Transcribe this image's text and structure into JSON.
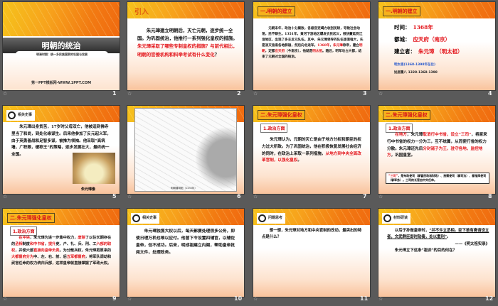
{
  "slides": [
    {
      "num": "1",
      "title": "明朝的统治",
      "subtitle": "明清时期：统一多民族国家的巩固与发展",
      "footer": "第一PPT模板网-WWW.1PPT.COM"
    },
    {
      "num": "2",
      "heading": "引入",
      "paras": [
        [
          {
            "t": "朱元璋建立明朝后，灭亡元朝，逐步统一全国。为巩固统治，他推行一系列强化皇权的措施。"
          },
          {
            "t": "朱元璋采取了哪些专制皇权的措施？与前代相比，明朝的官僚机构和科举考试有什么变化",
            "r": 1
          },
          {
            "t": "？"
          }
        ]
      ]
    },
    {
      "num": "3",
      "heading": "一.明朝的建立",
      "paras": [
        [
          {
            "t": "元朝末年，政治十分腐败，各级官吏竭力收刮民财，导致社会动荡，民不聊生。1351年，黄河下游地区爆发农民起义，很快蔓延到江淮地区，出现了多支反元队伍。其中，朱元璋领导的队伍逐渐强大，先是消灭淮南各地群雄，然后向北进军。"
          },
          {
            "t": "1368年",
            "r": 1
          },
          {
            "t": "，"
          },
          {
            "t": "朱元璋",
            "r": 1
          },
          {
            "t": "称帝，建立"
          },
          {
            "t": "明朝",
            "r": 1
          },
          {
            "t": "，定都"
          },
          {
            "t": "应天府",
            "r": 1
          },
          {
            "t": "（今南京），他就是"
          },
          {
            "t": "明太祖",
            "r": 1
          },
          {
            "t": "。随后，明军攻占大都，结束了元朝对全国的统治。"
          }
        ]
      ]
    },
    {
      "num": "4",
      "heading": "一.明朝的建立",
      "rows": [
        {
          "k": "时间：",
          "v": "1368年"
        },
        {
          "k": "都城：",
          "v": "应天府（南京）"
        },
        {
          "k": "建立者：",
          "v": "朱元璋 （明太祖）"
        }
      ],
      "note1": "明太祖(1368-1398年在位)",
      "note2": "姑居重八  1328-1368-1398"
    },
    {
      "num": "5",
      "badge": "相关史事",
      "paras": [
        [
          {
            "t": "朱元璋出身贫苦，17岁时父母双亡，他被迫到佛寺里当了和尚，到处化缘谋生。后来他参加了反元起义军，由于英勇善战和足智多谋，被推为领袖。他采取“高筑墙，广积粮，缓称王”的策略，逐步发展壮大，最终统一全国。"
          }
        ]
      ],
      "caption": "朱元璋像"
    },
    {
      "num": "6",
      "map_caption": "明朝疆域图（1433年）"
    },
    {
      "num": "7",
      "heading": "二.朱元璋强化皇权",
      "sub": "1.政治方面",
      "paras": [
        [
          {
            "t": "朱元璋认为，元朝的灭亡是由于地方分权和朝臣的权力过大所致。为了巩固统治，他在积极恢复发展社会经济的同时，在政治上采取一系列措施，"
          },
          {
            "t": "从地方到中央全面改革官制，以强化皇权",
            "r": 1
          },
          {
            "t": "。"
          }
        ]
      ]
    },
    {
      "num": "8",
      "heading": "二.朱元璋强化皇权",
      "sub": "1.政治方面",
      "paras": [
        [
          {
            "t": "在地方",
            "r": 1
          },
          {
            "t": "，朱元璋"
          },
          {
            "t": "取消行中书省，设立“三司”",
            "r": 1
          },
          {
            "t": "，将原来行中书省的权力一分为三，互不统属，从而使行省的权力分散。朱元璋还先后"
          },
          {
            "t": "分封诸子为王，驻守各地，监控地方",
            "r": 1
          },
          {
            "t": "，巩固皇室。"
          }
        ]
      ],
      "box": [
        {
          "t": "“三司”",
          "r": 1
        },
        {
          "t": "，是布政使司（掌管民政和财政）、按察使司（掌司法）、都指挥使司（掌军务）。三司的长官由中央任命。"
        }
      ]
    },
    {
      "num": "9",
      "heading": "二.朱元璋强化皇权",
      "sub": "1.政治方面",
      "paras": [
        [
          {
            "t": "在中央",
            "r": 1
          },
          {
            "t": "，朱元璋为进一步集中权力，"
          },
          {
            "t": "废除",
            "r": 1
          },
          {
            "t": "了以往长期存在的"
          },
          {
            "t": "丞相",
            "r": 1
          },
          {
            "t": "制度"
          },
          {
            "t": "和中书省",
            "r": 1
          },
          {
            "t": "，"
          },
          {
            "t": "提升",
            "r": 1
          },
          {
            "t": "吏、户、礼、兵、刑、工"
          },
          {
            "t": "六部的职权",
            "r": 1
          },
          {
            "t": "，并使六部"
          },
          {
            "t": "直接向皇帝负责",
            "r": 1
          },
          {
            "t": "。为分散兵权，朱元璋把原来的"
          },
          {
            "t": "大都督府分为",
            "r": 1
          },
          {
            "t": "中、左、右、前、后"
          },
          {
            "t": "五军都督府",
            "r": 1
          },
          {
            "t": "，将军队调动和武官任命的权力统归兵部，这样皇帝就直接掌握了军政大权。"
          }
        ]
      ]
    },
    {
      "num": "10",
      "badge": "相关史事",
      "paras": [
        [
          {
            "t": "朱元璋独揽大权以后，每天都要处理很多公务，即使日理万机也难以应付。他曾下令设置四辅官，以辅佐皇帝，但不成功。后来，明成祖建立内阁，帮助皇帝批阅文件，处理政务。"
          }
        ]
      ]
    },
    {
      "num": "11",
      "badge": "问题思考",
      "paras": [
        [
          {
            "t": "想一想，朱元璋对地方和中央官制的改动，最突出的特点是什么？"
          }
        ]
      ]
    },
    {
      "num": "12",
      "badge": "材料研读",
      "paras": [
        [
          {
            "t": "以后子孙做皇帝时，"
          },
          {
            "t": "“并不许立丞相。臣下敢有奏请设立者，文武群臣即时劾奏，处以重刑”",
            "u": 1
          },
          {
            "t": "。"
          }
        ],
        [
          {
            "t": "——《明太祖实录》"
          }
        ],
        [
          {
            "t": "朱元璋立下这条“祖训”的目的何在？"
          }
        ]
      ]
    }
  ]
}
